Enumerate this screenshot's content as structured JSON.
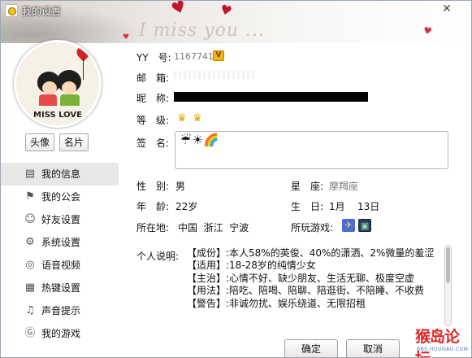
{
  "window": {
    "title": "我的设置",
    "close_glyph": "✕",
    "banner_text": "I miss you ...",
    "banner_heart_glyph": "♥"
  },
  "profile": {
    "avatar_caption": "MISS LOVE",
    "avatar_button": "头像",
    "card_button": "名片"
  },
  "nav": {
    "items": [
      {
        "label": "我的信息",
        "icon": "profile-card-icon",
        "glyph": "▤",
        "active": true
      },
      {
        "label": "我的公会",
        "icon": "flag-icon",
        "glyph": "⚑",
        "active": false
      },
      {
        "label": "好友设置",
        "icon": "friends-icon",
        "glyph": "☺",
        "active": false
      },
      {
        "label": "系统设置",
        "icon": "gear-icon",
        "glyph": "⚙",
        "active": false
      },
      {
        "label": "语音视频",
        "icon": "headset-icon",
        "glyph": "◎",
        "active": false
      },
      {
        "label": "热键设置",
        "icon": "keyboard-icon",
        "glyph": "▦",
        "active": false
      },
      {
        "label": "声音提示",
        "icon": "music-note-icon",
        "glyph": "♫",
        "active": false
      },
      {
        "label": "我的游戏",
        "icon": "game-g-icon",
        "glyph": "Ⓖ",
        "active": false
      }
    ]
  },
  "info": {
    "yy_label": "YY　号:",
    "yy_value": "1167741",
    "vip_glyph": "V",
    "mail_label": "邮　箱:",
    "nick_label": "昵　称:",
    "level_label": "等　级:",
    "crown_glyph": "♛",
    "sign_label": "签　名:",
    "sign_emojis": [
      "☔",
      "☀",
      "🌈"
    ],
    "gender_label": "性　别:",
    "gender_value": "男",
    "sign_zodiac_label": "星　座:",
    "zodiac_value": "摩羯座",
    "age_label": "年　龄:",
    "age_value": "22岁",
    "birthday_label": "生　日:",
    "birthday_month": "1月",
    "birthday_day": "13日",
    "location_label": "所在地:",
    "location_value": "中国  浙江  宁波",
    "games_label": "所玩游戏:",
    "game_icons": [
      "game-fighter-icon",
      "game-frame-icon"
    ],
    "desc_label": "个人说明:",
    "desc_lines": [
      "【成份】:本人58%的英俊、40%的潇洒、2%微量的羞涩",
      "【适用】:18-28岁的纯情少女",
      "【主治】:心情不好、缺少朋友、生活无聊、极度空虚",
      "【用法】:陪吃、陪喝、陪聊、陪逛街、不陪睡、不收费",
      "【警告】:非诚勿扰、娱乐绕道、无限招租"
    ]
  },
  "buttons": {
    "ok": "确定",
    "cancel": "取消"
  },
  "watermark": {
    "main": "猴岛论坛",
    "sub": "BBS.HOUDAO.COM"
  },
  "colors": {
    "watermark_red": "#e02828",
    "heart_red": "#c0162a",
    "nav_active_bg": "#e7e7e7"
  }
}
